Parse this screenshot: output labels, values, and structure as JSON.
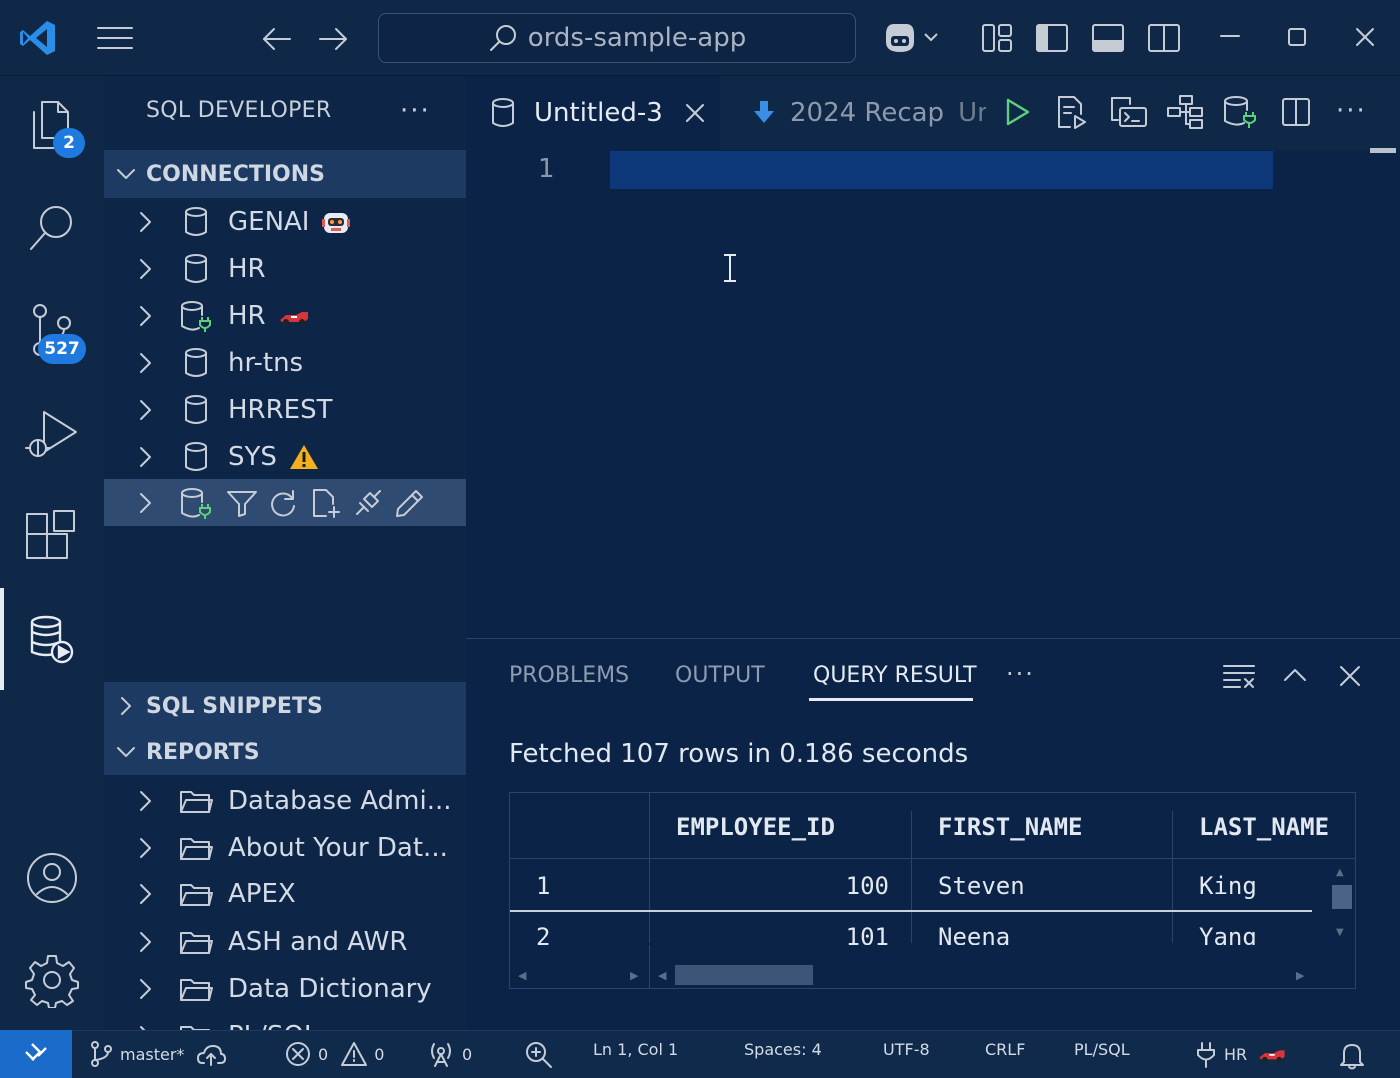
{
  "window": {
    "search_text": "ords-sample-app"
  },
  "activity": {
    "explorer_badge": "2",
    "scm_badge": "527"
  },
  "sidebar": {
    "title": "SQL DEVELOPER",
    "more": "···",
    "connections_header": "CONNECTIONS",
    "connections": [
      {
        "label": "GENAI",
        "decoration": "robot"
      },
      {
        "label": "HR",
        "decoration": ""
      },
      {
        "label": "HR",
        "decoration": "race-car"
      },
      {
        "label": "hr-tns",
        "decoration": ""
      },
      {
        "label": "HRREST",
        "decoration": ""
      },
      {
        "label": "SYS",
        "decoration": "warning"
      }
    ],
    "snippets_header": "SQL SNIPPETS",
    "reports_header": "REPORTS",
    "reports": [
      "Database Admi...",
      "About Your Dat...",
      "APEX",
      "ASH and AWR",
      "Data Dictionary",
      "PL/SQL"
    ]
  },
  "editor": {
    "active_tab": "Untitled-3",
    "second_tab": "2024 Recap",
    "second_tab_suffix": "Unt",
    "line_number": "1"
  },
  "panel": {
    "tabs": [
      "PROBLEMS",
      "OUTPUT",
      "QUERY RESULT"
    ],
    "active_tab": "QUERY RESULT",
    "more": "···",
    "fetched": "Fetched 107 rows in 0.186 seconds",
    "columns": [
      "EMPLOYEE_ID",
      "FIRST_NAME",
      "LAST_NAME"
    ],
    "rows": [
      {
        "n": "1",
        "EMPLOYEE_ID": "100",
        "FIRST_NAME": "Steven",
        "LAST_NAME": "King"
      },
      {
        "n": "2",
        "EMPLOYEE_ID": "101",
        "FIRST_NAME": "Neena",
        "LAST_NAME": "Yang"
      }
    ]
  },
  "status": {
    "branch": "master*",
    "errors": "0",
    "warnings": "0",
    "ports": "0",
    "position": "Ln 1, Col 1",
    "spaces": "Spaces: 4",
    "encoding": "UTF-8",
    "eol": "CRLF",
    "language": "PL/SQL",
    "connection": "HR"
  },
  "colors": {
    "accent": "#1f7ae0",
    "background": "#0b2346",
    "selection": "#0c3778"
  }
}
